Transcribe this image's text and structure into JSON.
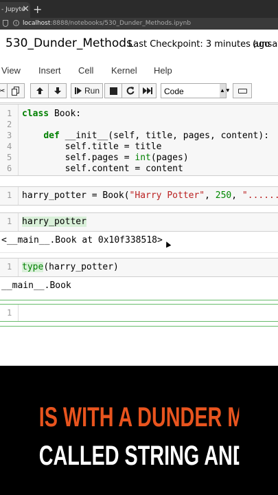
{
  "browser": {
    "tab_title": "- Jupyte",
    "tab_close": "✕",
    "new_tab": "+",
    "url_host": "localhost",
    "url_path": ":8888/notebooks/530_Dunder_Methods.ipynb"
  },
  "notebook": {
    "name": "530_Dunder_Methods",
    "checkpoint": "Last Checkpoint: 3 minutes ago",
    "unsaved": "(unsaved"
  },
  "menu": [
    "View",
    "Insert",
    "Cell",
    "Kernel",
    "Help"
  ],
  "toolbar": {
    "run_label": "Run",
    "cell_type": "Code"
  },
  "cells": {
    "c1_lines": [
      "1",
      "2",
      "3",
      "4",
      "5",
      "6"
    ],
    "c1_class_kw": "class",
    "c1_class_name": " Book:",
    "c1_def_kw": "def",
    "c1_def_rest": " __init__(self, title, pages, content):",
    "c1_line4": "        self.title = title",
    "c1_line5_a": "        self.pages = ",
    "c1_line5_int": "int",
    "c1_line5_b": "(pages)",
    "c1_line6": "        self.content = content",
    "c2_line": "1",
    "c2_a": "harry_potter = Book(",
    "c2_str": "\"Harry Potter\"",
    "c2_b": ", ",
    "c2_num": "250",
    "c2_c": ", ",
    "c2_str2": "\"......",
    "c3_line": "1",
    "c3_code": "harry_potter",
    "c3_out": "<__main__.Book at 0x10f338518>",
    "c4_line": "1",
    "c4_type": "type",
    "c4_rest": "(harry_potter)",
    "c4_out": "__main__.Book",
    "c5_line": "1"
  },
  "captions": {
    "line1": "IS WITH A DUNDER METHOD",
    "line2": "CALLED STRING AND"
  },
  "colors": {
    "caption_accent": "#e8541e",
    "keyword": "#008000",
    "string": "#ba2121",
    "active_cell": "#66bb6a"
  }
}
